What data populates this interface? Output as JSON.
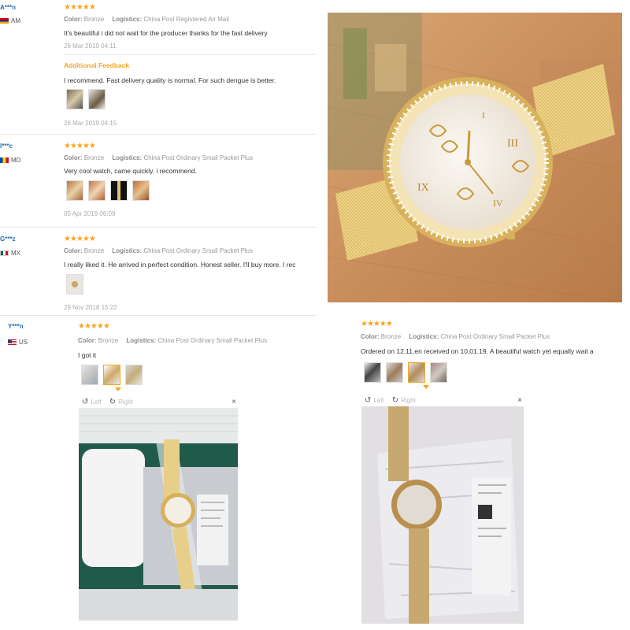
{
  "reviews": [
    {
      "user": "A***n",
      "country": "AM",
      "stars": "★★★★★",
      "color_label": "Color:",
      "color_value": "Bronze",
      "logistics_label": "Logistics:",
      "logistics_value": "China Post Registered Air Mail",
      "text": "It's beautiful i did not wait for the producer thanks for the fast delivery",
      "date": "26 Mar 2019 04:11",
      "additional_label": "Additional Feedback",
      "additional_text": "I recommend. Fast delivery quality is normal. For such dengue is better.",
      "additional_date": "26 Mar 2019 04:15"
    },
    {
      "user": "I***c",
      "country": "MD",
      "stars": "★★★★★",
      "color_label": "Color:",
      "color_value": "Bronze",
      "logistics_label": "Logistics:",
      "logistics_value": "China Post Ordinary Small Packet Plus",
      "text": "Very cool watch, came quickly. i recommend.",
      "date": "05 Apr 2019 06:09"
    },
    {
      "user": "G***z",
      "country": "MX",
      "stars": "★★★★★",
      "color_label": "Color:",
      "color_value": "Bronze",
      "logistics_label": "Logistics:",
      "logistics_value": "China Post Ordinary Small Packet Plus",
      "text": "I really liked it. He arrived in perfect condition. Honest seller. I'll buy more. I rec",
      "date": "29 Nov 2018 15:22"
    },
    {
      "user": "Y***n",
      "country": "US",
      "stars": "★★★★★",
      "color_label": "Color:",
      "color_value": "Bronze",
      "logistics_label": "Logistics:",
      "logistics_value": "China Post Ordinary Small Packet Plus",
      "text": "I got it",
      "viewer_left": "Left",
      "viewer_right": "Right",
      "viewer_close": "×"
    },
    {
      "stars": "★★★★★",
      "color_label": "Color:",
      "color_value": "Bronze",
      "logistics_label": "Logistics:",
      "logistics_value": "China Post Ordinary Small Packet Plus",
      "text": "Ordered on 12.11.en received on 10.01.19. A beautiful watch yet equally wait a",
      "viewer_left": "Left",
      "viewer_right": "Right",
      "viewer_close": "×"
    }
  ],
  "icons": {
    "rotate_left": "↺",
    "rotate_right": "↻"
  },
  "colors": {
    "star": "#f5a623",
    "username": "#2a6bb3",
    "additional": "#f5a623"
  }
}
